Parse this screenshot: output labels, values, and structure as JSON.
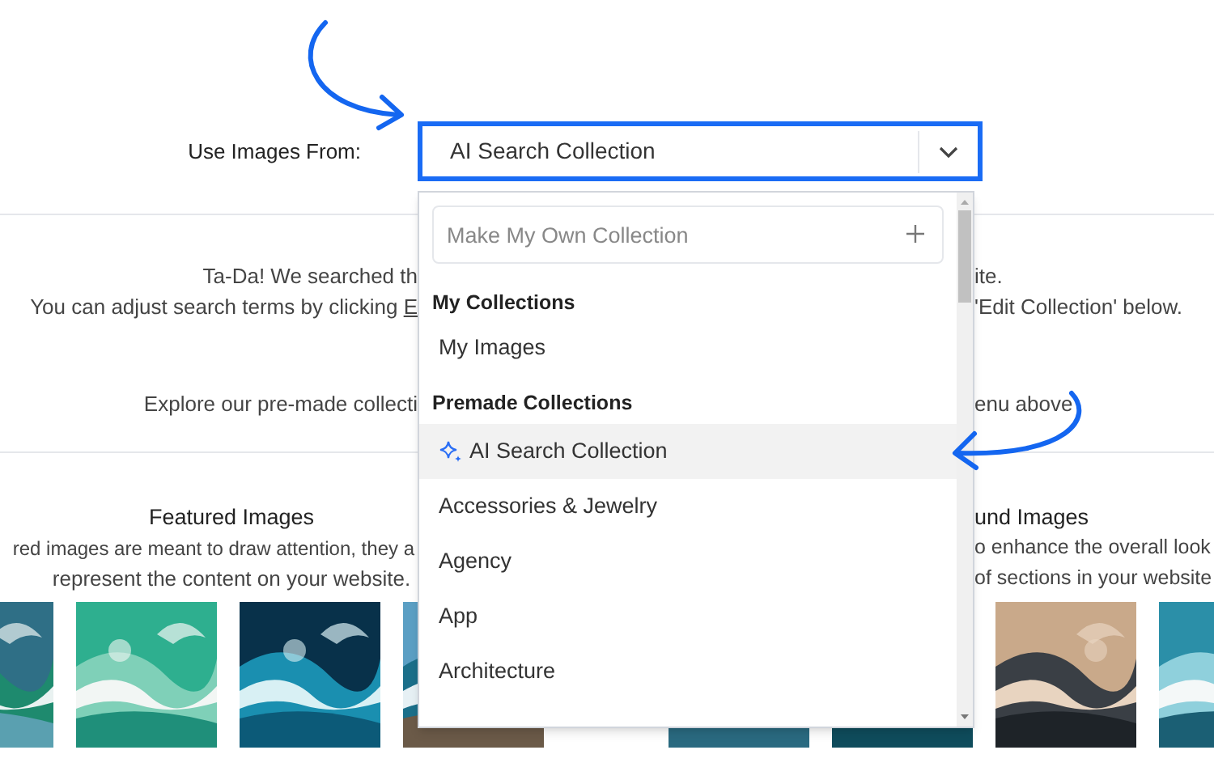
{
  "source": {
    "label": "Use Images From:",
    "select": {
      "value": "AI Search Collection",
      "focused": true
    }
  },
  "message_lines": [
    {
      "left": "Ta-Da! We searched th",
      "right": "ite."
    },
    {
      "left": "You can adjust search terms by clicking ",
      "link": "E",
      "right": "'Edit Collection' below."
    }
  ],
  "explore": {
    "left": "Explore our pre-made collecti",
    "right": "enu above"
  },
  "sections": [
    {
      "title": "Featured Images",
      "lines": [
        "red images are meant to draw attention, they a",
        "represent the content on your website."
      ]
    },
    {
      "title": "und Images",
      "lines": [
        "o enhance the overall look",
        "of sections in your website"
      ]
    }
  ],
  "dropdown": {
    "search_placeholder": "Make My Own Collection",
    "groups": [
      {
        "title": "My Collections",
        "items": [
          {
            "label": "My Images",
            "kind": "plain",
            "selected": false
          }
        ]
      },
      {
        "title": "Premade Collections",
        "items": [
          {
            "label": "AI Search Collection",
            "kind": "ai",
            "selected": true
          },
          {
            "label": "Accessories & Jewelry",
            "kind": "plain",
            "selected": false
          },
          {
            "label": "Agency",
            "kind": "plain",
            "selected": false
          },
          {
            "label": "App",
            "kind": "plain",
            "selected": false
          },
          {
            "label": "Architecture",
            "kind": "plain",
            "selected": false
          }
        ]
      }
    ]
  }
}
